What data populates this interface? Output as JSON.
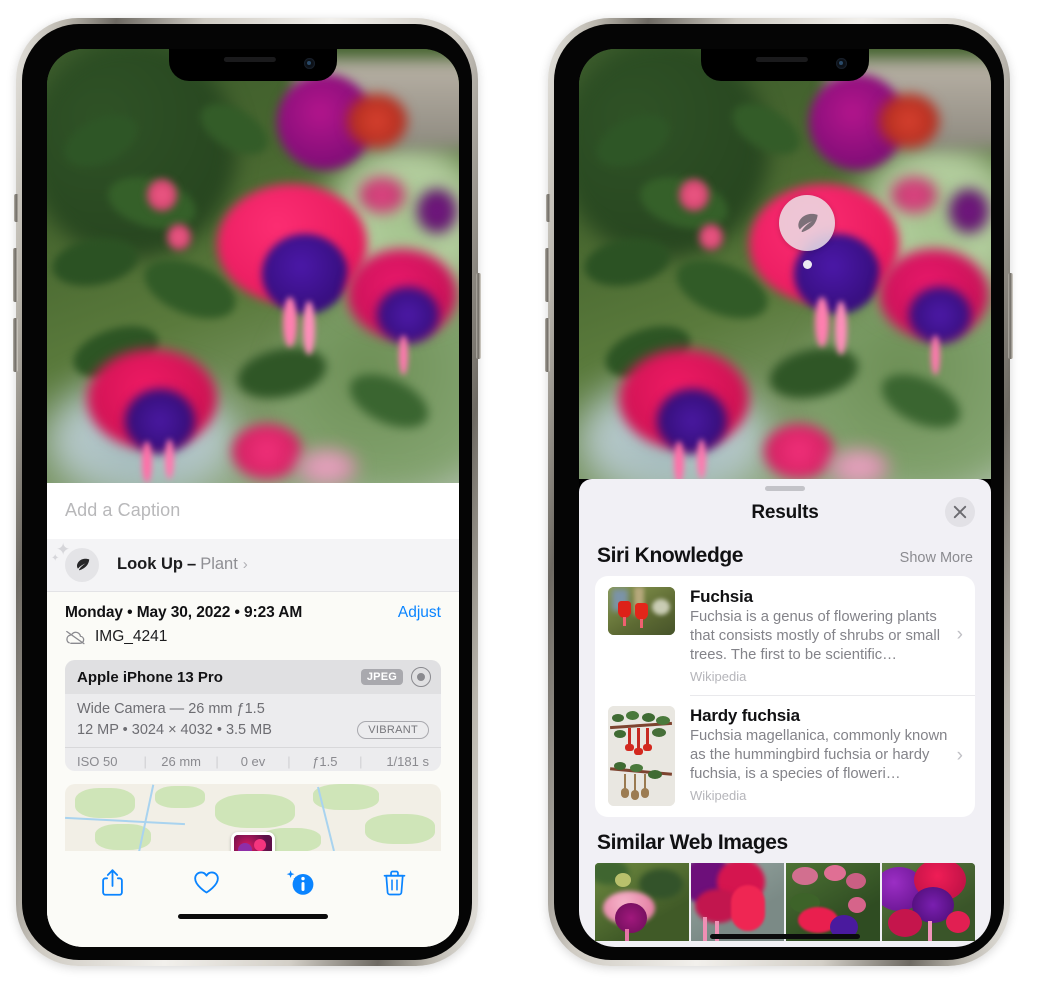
{
  "phones": {
    "left": {
      "name": "photo-info-screen",
      "caption": {
        "placeholder": "Add a Caption",
        "value": ""
      },
      "look_up": {
        "icon": "leaf-icon",
        "label": "Look Up",
        "dash": "–",
        "subject": "Plant",
        "chevron": "›"
      },
      "metadata": {
        "date": "Monday • May 30, 2022 • 9:23 AM",
        "adjust_label": "Adjust",
        "cloud_icon": "icloud-slash-icon",
        "filename": "IMG_4241"
      },
      "camera_card": {
        "device": "Apple iPhone 13 Pro",
        "format_chip": "JPEG",
        "raw_icon": "raw-lens-icon",
        "lens_line": "Wide Camera — 26 mm ƒ1.5",
        "specs_line": "12 MP • 3024 × 4032 • 3.5 MB",
        "style_chip": "VIBRANT",
        "exif": [
          "ISO 50",
          "26 mm",
          "0 ev",
          "ƒ1.5",
          "1/181 s"
        ]
      },
      "toolbar": [
        {
          "name": "share-button",
          "icon": "share-icon"
        },
        {
          "name": "favorite-button",
          "icon": "heart-icon"
        },
        {
          "name": "info-button",
          "icon": "info-sparkle-icon"
        },
        {
          "name": "delete-button",
          "icon": "trash-icon"
        }
      ]
    },
    "right": {
      "name": "visual-lookup-results-screen",
      "badge": {
        "icon": "leaf-icon"
      },
      "sheet": {
        "title": "Results",
        "close_icon": "close-icon",
        "sections": [
          {
            "title": "Siri Knowledge",
            "action": "Show More",
            "items": [
              {
                "title": "Fuchsia",
                "description": "Fuchsia is a genus of flowering plants that consists mostly of shrubs or small trees. The first to be scientific…",
                "source": "Wikipedia",
                "chevron": "›",
                "thumb": "fuchsia-red-flowers-thumb"
              },
              {
                "title": "Hardy fuchsia",
                "description": "Fuchsia magellanica, commonly known as the hummingbird fuchsia or hardy fuchsia, is a species of floweri…",
                "source": "Wikipedia",
                "chevron": "›",
                "thumb": "hardy-fuchsia-specimen-thumb"
              }
            ]
          },
          {
            "title": "Similar Web Images",
            "action": "",
            "images": [
              "fuchsia-pink-white-thumb",
              "fuchsia-magenta-closeup-thumb",
              "fuchsia-shrub-thumb",
              "fuchsia-purple-red-thumb"
            ]
          }
        ]
      }
    }
  },
  "colors": {
    "accent_blue": "#0a84ff",
    "sheet_bg": "#f1f0f5",
    "info_bg": "#fbfbf7",
    "card_bg": "#ffffff",
    "secondary_text": "#8e8e93"
  }
}
